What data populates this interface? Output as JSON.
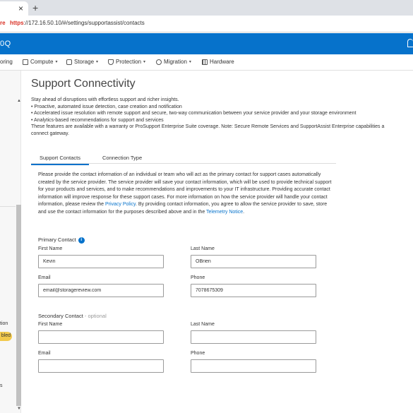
{
  "browser": {
    "tab_close": "×",
    "new_tab": "+",
    "security_label": "re",
    "url_scheme": "https",
    "url_rest": "://172.16.50.10/#/settings/supportassist/contacts"
  },
  "app": {
    "title": "0Q",
    "icons": {
      "bell": "bell-icon"
    }
  },
  "nav": {
    "items": [
      {
        "label": "oring"
      },
      {
        "label": "Compute",
        "icon": "page-icon"
      },
      {
        "label": "Storage",
        "icon": "database-icon"
      },
      {
        "label": "Protection",
        "icon": "shield-icon"
      },
      {
        "label": "Migration",
        "icon": "migration-icon"
      },
      {
        "label": "Hardware",
        "icon": "grid-icon"
      }
    ],
    "caret": "▾"
  },
  "sidebar": {
    "texts": [
      "tion",
      "bled",
      "s"
    ]
  },
  "page": {
    "title": "Support Connectivity",
    "intro_lines": [
      "Stay ahead of disruptions with effortless support and richer insights.",
      "• Proactive, automated issue detection, case creation and notification",
      "• Accelerated issue resolution with remote support and secure, two-way communication between your service provider and your storage environment",
      "• Analytics-based recommendations for support and services",
      "These features are available with a warranty or ProSupport Enterprise Suite coverage. Note: Secure Remote Services and SupportAssist Enterprise capabilities a",
      "connect gateway."
    ],
    "tabs": [
      "Support Contacts",
      "Connection Type"
    ],
    "description_part1": "Please provide the contact information of an individual or team who will act as the primary contact for support cases automatically created by the service provider. The service provider will save your contact information, which will be used to provide technical support for your products and services, and to make recommendations and improvements to your IT infrastructure. Providing accurate contact information will improve response for these support cases. For more information on how the service provider will handle your contact information, please review the ",
    "privacy_link": "Privacy Policy",
    "description_part2": ". By providing contact information, you agree to allow the service provider to save, store and use the contact information for the purposes described above and in the ",
    "telemetry_link": "Telemetry Notice",
    "description_end": "."
  },
  "primary_contact": {
    "heading": "Primary Contact",
    "info_icon": "i",
    "first_name_label": "First Name",
    "first_name": "Kevin",
    "last_name_label": "Last Name",
    "last_name": "OBrien",
    "email_label": "Email",
    "email": "email@storagereview.com",
    "phone_label": "Phone",
    "phone": "7078675309"
  },
  "secondary_contact": {
    "heading": "Secondary Contact",
    "optional": " - optional",
    "first_name_label": "First Name",
    "first_name": "",
    "last_name_label": "Last Name",
    "last_name": "",
    "email_label": "Email",
    "email": "",
    "phone_label": "Phone",
    "phone": ""
  },
  "colors": {
    "accent": "#0672cb",
    "badge": "#f2c94c"
  }
}
